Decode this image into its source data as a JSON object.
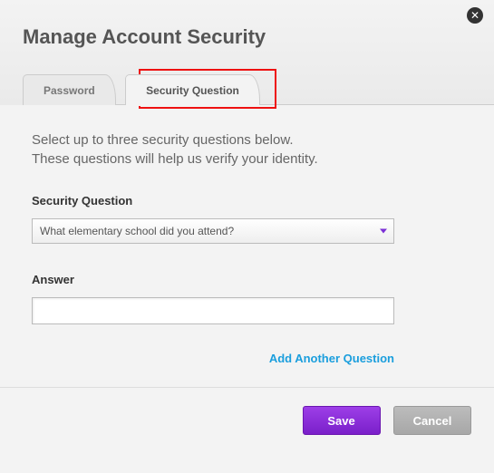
{
  "header": {
    "title": "Manage Account Security"
  },
  "tabs": {
    "password": "Password",
    "security_question": "Security Question"
  },
  "intro": {
    "line1": "Select up to three security questions below.",
    "line2": "These questions will help us verify your identity."
  },
  "form": {
    "question_label": "Security Question",
    "question_value": "What elementary school did you attend?",
    "answer_label": "Answer",
    "answer_value": "",
    "add_link": "Add Another Question"
  },
  "footer": {
    "save": "Save",
    "cancel": "Cancel"
  },
  "icons": {
    "close": "✕"
  }
}
